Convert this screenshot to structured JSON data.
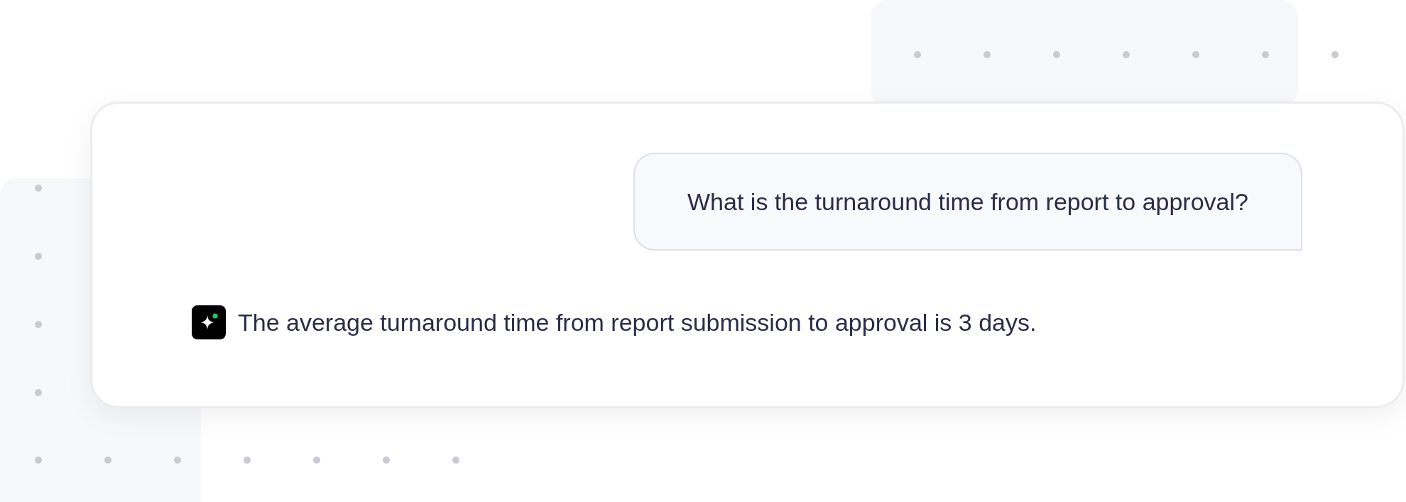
{
  "messages": [
    {
      "kind": "user",
      "text": "What is the turnaround time from report to approval?"
    },
    {
      "kind": "assistant",
      "text": "The average turnaround time from report submission to approval is 3 days."
    }
  ]
}
